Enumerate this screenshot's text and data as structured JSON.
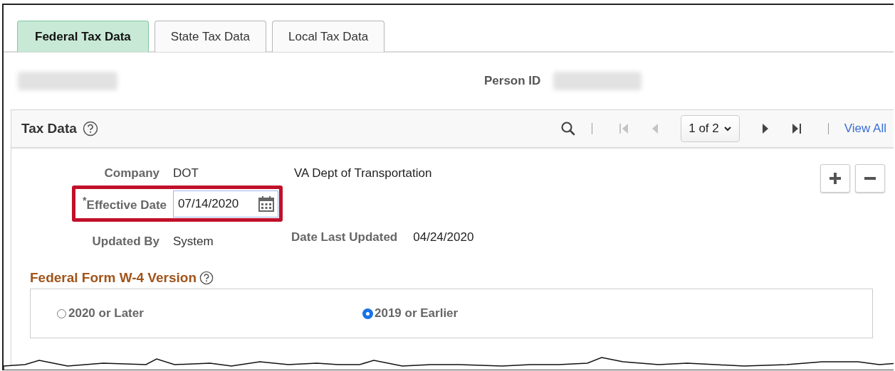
{
  "tabs": [
    {
      "label": "Federal Tax Data",
      "selected": true
    },
    {
      "label": "State Tax Data",
      "selected": false
    },
    {
      "label": "Local Tax Data",
      "selected": false
    }
  ],
  "person": {
    "id_label": "Person ID"
  },
  "panel": {
    "title": "Tax Data",
    "pager": "1 of 2",
    "view_all": "View All",
    "nav": [
      {
        "kind": "first",
        "disabled": true
      },
      {
        "kind": "prev",
        "disabled": true
      },
      {
        "kind": "next",
        "disabled": false
      },
      {
        "kind": "last",
        "disabled": false
      }
    ]
  },
  "company": {
    "label": "Company",
    "value": "DOT",
    "description": "VA Dept of Transportation"
  },
  "effective_date": {
    "label": "$^{*}$Effective Date",
    "value": "07/14/2020",
    "highlighted": true
  },
  "updated_by": {
    "label": "Updated By",
    "value": "System"
  },
  "date_last_updated": {
    "label": "Date Last Updated",
    "value": "04/24/2020"
  },
  "w4": {
    "title": "Federal Form W-4 Version",
    "options": [
      {
        "label": "2020 or Later",
        "selected": false
      },
      {
        "label": "2019 or Earlier",
        "selected": true
      }
    ]
  }
}
